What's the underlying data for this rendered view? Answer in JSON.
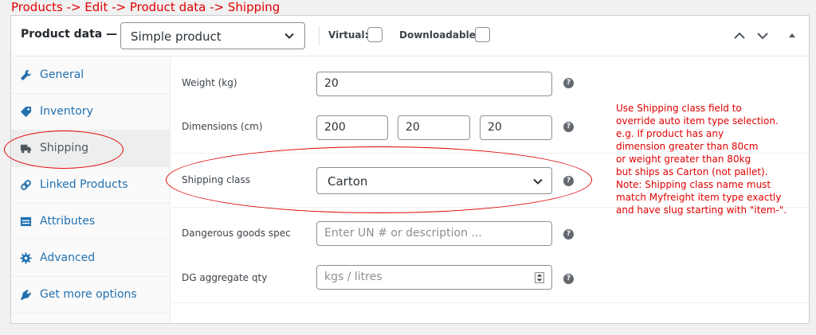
{
  "caption": "Products -> Edit -> Product data -> Shipping",
  "header": {
    "title": "Product data —",
    "product_type": "Simple product",
    "virtual_label": "Virtual:",
    "downloadable_label": "Downloadable:"
  },
  "sidebar": {
    "items": [
      {
        "label": "General",
        "icon": "wrench-icon"
      },
      {
        "label": "Inventory",
        "icon": "tag-icon"
      },
      {
        "label": "Shipping",
        "icon": "truck-icon"
      },
      {
        "label": "Linked Products",
        "icon": "link-icon"
      },
      {
        "label": "Attributes",
        "icon": "table-icon"
      },
      {
        "label": "Advanced",
        "icon": "gear-icon"
      },
      {
        "label": "Get more options",
        "icon": "plugin-icon"
      }
    ]
  },
  "fields": {
    "weight": {
      "label": "Weight (kg)",
      "value": "20"
    },
    "dimensions": {
      "label": "Dimensions (cm)",
      "length": "200",
      "width": "20",
      "height": "20"
    },
    "shipping_class": {
      "label": "Shipping class",
      "value": "Carton"
    },
    "dangerous_goods": {
      "label": "Dangerous goods spec",
      "placeholder": "Enter UN # or description ..."
    },
    "dg_qty": {
      "label": "DG aggregate qty",
      "placeholder": "kgs / litres"
    }
  },
  "note": [
    "Use Shipping class field to",
    "override auto item type selection.",
    "e.g. If product has any",
    "dimension greater than 80cm",
    "or weight greater than 80kg",
    "but ships as Carton (not pallet).",
    "Note: Shipping class name must",
    "match Myfreight item type exactly",
    "and have slug starting with \"item-\"."
  ],
  "colors": {
    "annotation": "#e00000",
    "link": "#2271b1",
    "active_tab_bg": "#eeeeee"
  }
}
